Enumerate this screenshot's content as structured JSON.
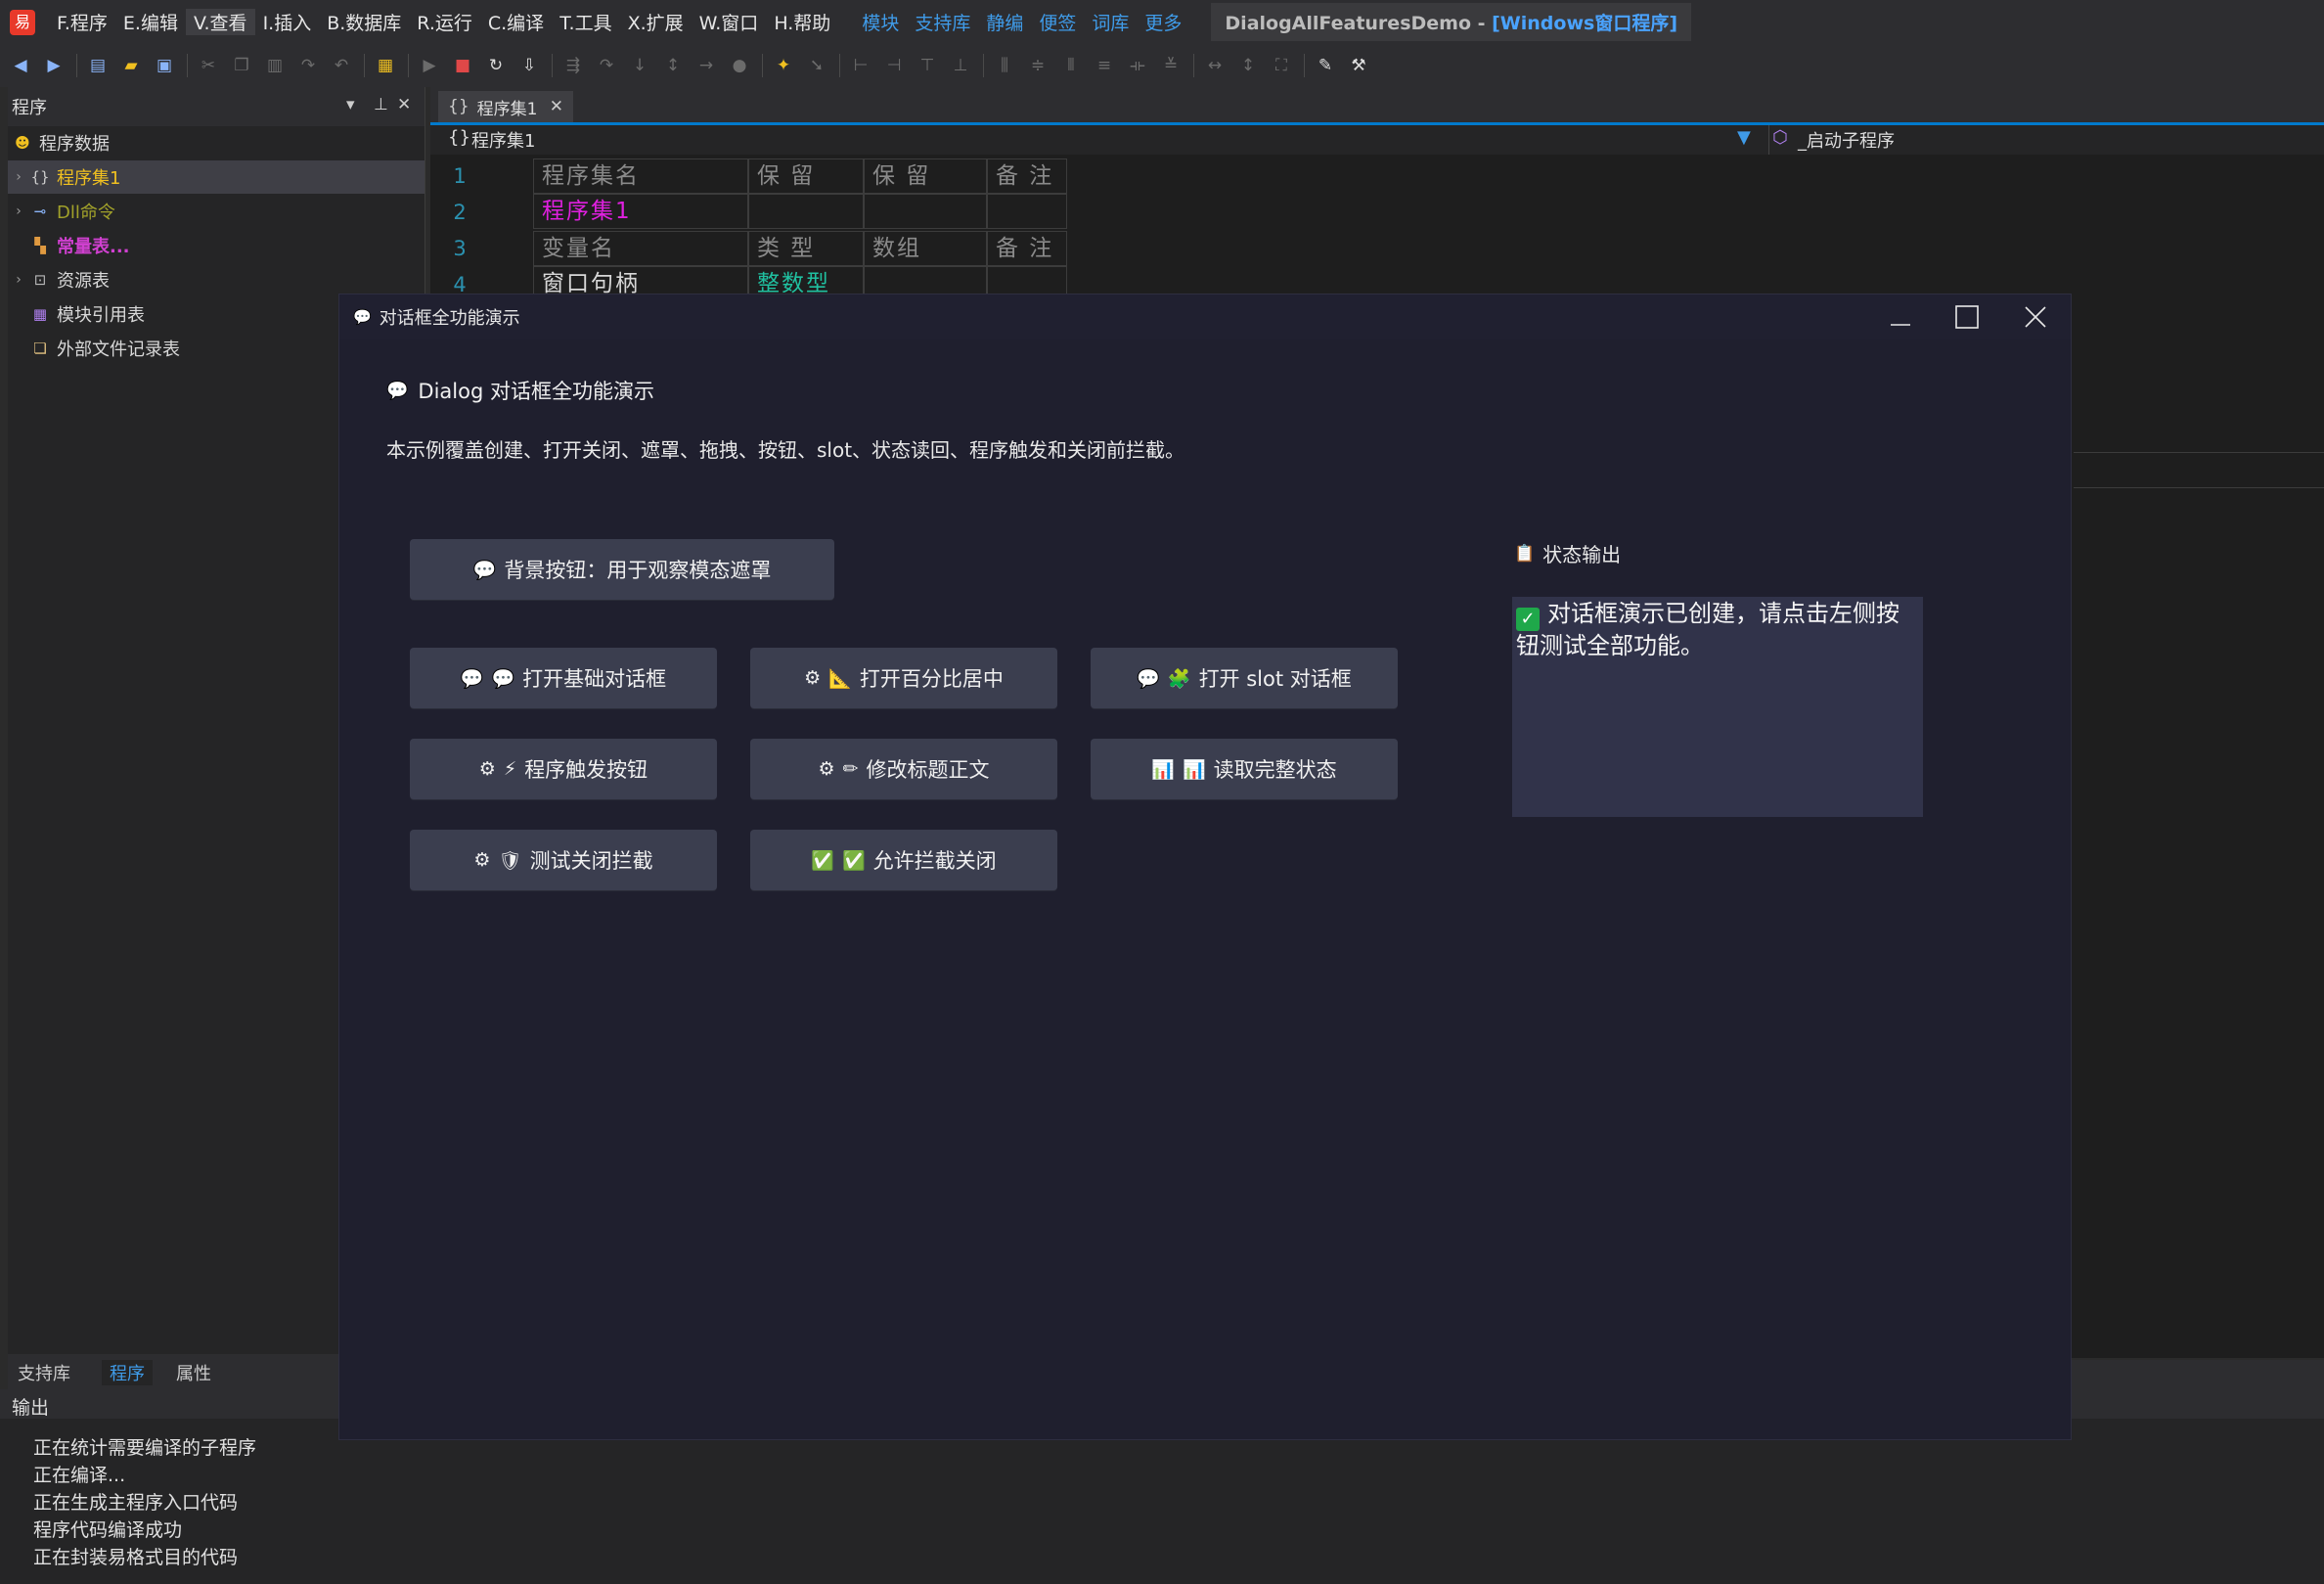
{
  "menubar": {
    "items": [
      "F.程序",
      "E.编辑",
      "V.查看",
      "I.插入",
      "B.数据库",
      "R.运行",
      "C.编译",
      "T.工具",
      "X.扩展",
      "W.窗口",
      "H.帮助"
    ],
    "links": [
      "模块",
      "支持库",
      "静编",
      "便签",
      "词库",
      "更多"
    ],
    "title_main": "DialogAllFeaturesDemo - ",
    "title_highlight": "[Windows窗口程序]"
  },
  "left_panel": {
    "title": "程序",
    "tree": [
      {
        "label": "程序数据",
        "icon": "smile-icon"
      },
      {
        "label": "程序集1",
        "icon": "braces-icon"
      },
      {
        "label": "Dll命令",
        "icon": "link-icon"
      },
      {
        "label": "常量表...",
        "icon": "constant-icon"
      },
      {
        "label": "资源表",
        "icon": "resource-icon"
      },
      {
        "label": "模块引用表",
        "icon": "module-icon"
      },
      {
        "label": "外部文件记录表",
        "icon": "file-record-icon"
      }
    ]
  },
  "editor": {
    "tab_label": "程序集1",
    "combo_left": "程序集1",
    "combo_right": "_启动子程序",
    "line_numbers": [
      "1",
      "2",
      "3",
      "4"
    ],
    "table": {
      "row1": [
        "程序集名",
        "保 留",
        "保 留",
        "备 注"
      ],
      "row2": [
        "程序集1",
        "",
        "",
        ""
      ],
      "row3": [
        "变量名",
        "类 型",
        "数组",
        "备 注"
      ],
      "row4": [
        "窗口句柄",
        "整数型",
        "",
        ""
      ]
    }
  },
  "bottom_tabs": [
    "支持库",
    "程序",
    "属性"
  ],
  "output": {
    "title": "输出",
    "lines": [
      "正在统计需要编译的子程序",
      "正在编译...",
      "正在生成主程序入口代码",
      "程序代码编译成功",
      "正在封装易格式目的代码"
    ]
  },
  "dialog": {
    "title": "对话框全功能演示",
    "heading": "Dialog 对话框全功能演示",
    "description": "本示例覆盖创建、打开关闭、遮罩、拖拽、按钮、slot、状态读回、程序触发和关闭前拦截。",
    "bg_button": "背景按钮：用于观察模态遮罩",
    "buttons": [
      {
        "label": "打开基础对话框",
        "icons": [
          "💬",
          "💬"
        ]
      },
      {
        "label": "打开百分比居中",
        "icons": [
          "⚙",
          "📐"
        ]
      },
      {
        "label": "打开 slot 对话框",
        "icons": [
          "💬",
          "🧩"
        ]
      },
      {
        "label": "程序触发按钮",
        "icons": [
          "⚙",
          "⚡"
        ]
      },
      {
        "label": "修改标题正文",
        "icons": [
          "⚙",
          "✏"
        ]
      },
      {
        "label": "读取完整状态",
        "icons": [
          "📊",
          "📊"
        ]
      },
      {
        "label": "测试关闭拦截",
        "icons": [
          "⚙",
          "🛡"
        ]
      },
      {
        "label": "允许拦截关闭",
        "icons": [
          "✅",
          "✅"
        ]
      }
    ],
    "status_title": "状态输出",
    "status_text": "对话框演示已创建，请点击左侧按钮测试全部功能。"
  }
}
